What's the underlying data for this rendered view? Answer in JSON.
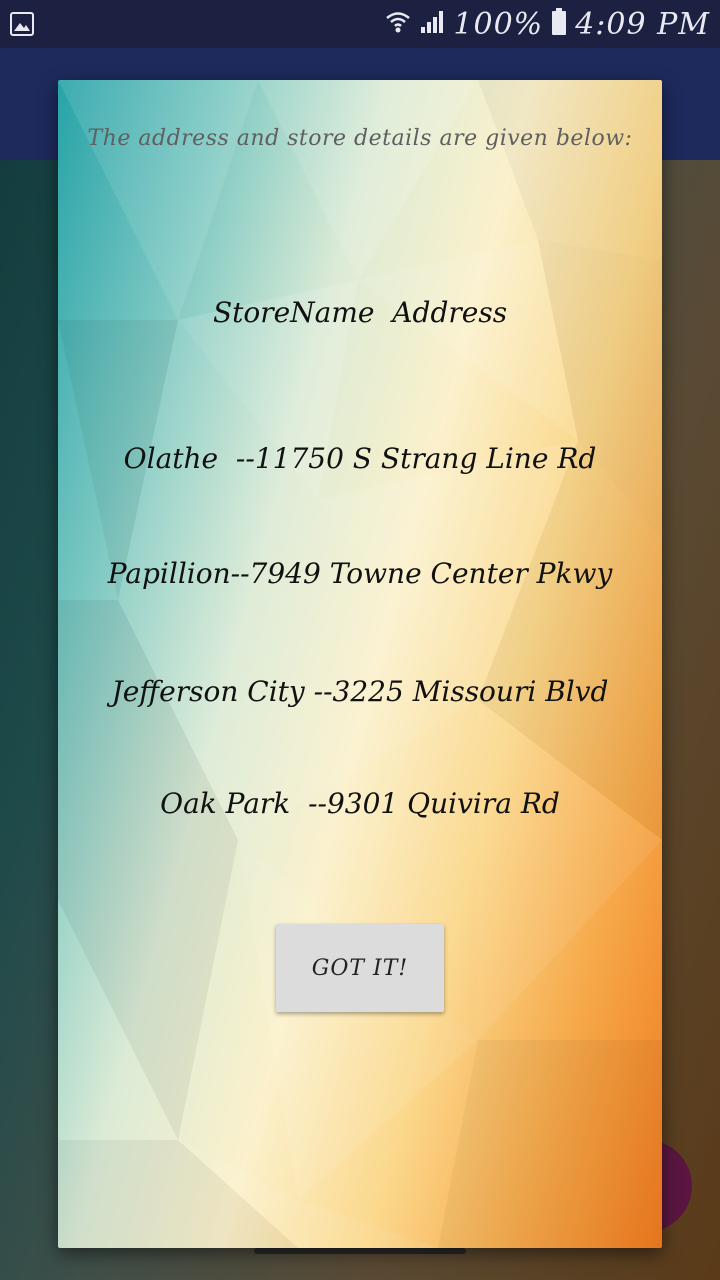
{
  "status_bar": {
    "battery": "100%",
    "time": "4:09 PM",
    "left_icon": "image-notification-icon",
    "wifi_icon": "wifi-icon",
    "signal_icon": "cell-signal-icon",
    "battery_icon": "battery-full-icon"
  },
  "dialog": {
    "intro": "The address and store details are given below:",
    "header": "StoreName  Address",
    "stores": [
      "Olathe  --11750 S Strang Line Rd",
      "Papillion--7949 Towne Center Pkwy",
      "Jefferson City --3225 Missouri Blvd",
      "Oak Park  --9301 Quivira Rd"
    ],
    "button_label": "GOT IT!"
  },
  "colors": {
    "status_bar": "#1c2142",
    "toolbar": "#1e2a5c",
    "button": "#dcdcdc",
    "gradient_teal": "#27a3a8",
    "gradient_cream": "#fbf1cc",
    "gradient_orange": "#ef7a1f"
  }
}
